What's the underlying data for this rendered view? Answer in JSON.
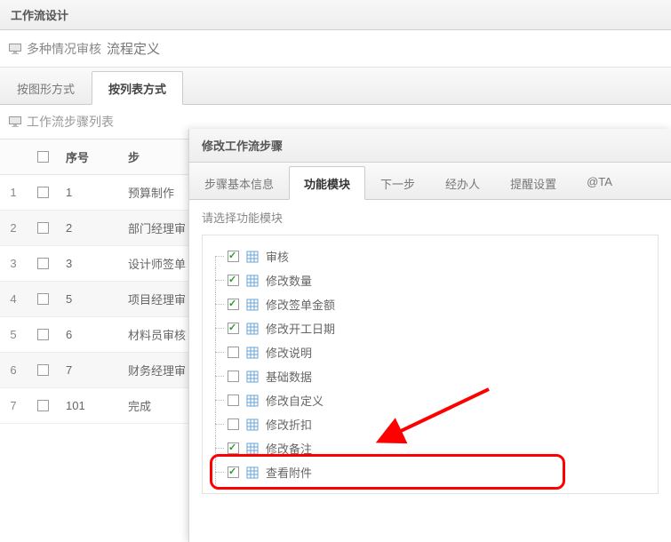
{
  "header": {
    "title": "工作流设计"
  },
  "subheader": {
    "breadcrumb1": "多种情况审核",
    "breadcrumb2": "流程定义"
  },
  "main_tabs": [
    {
      "label": "按图形方式",
      "active": false
    },
    {
      "label": "按列表方式",
      "active": true
    }
  ],
  "list_title": "工作流步骤列表",
  "table": {
    "headers": {
      "num": "序号",
      "name": "步"
    },
    "rows": [
      {
        "idx": "1",
        "num": "1",
        "name": "预算制作"
      },
      {
        "idx": "2",
        "num": "2",
        "name": "部门经理审"
      },
      {
        "idx": "3",
        "num": "3",
        "name": "设计师签单"
      },
      {
        "idx": "4",
        "num": "5",
        "name": "项目经理审"
      },
      {
        "idx": "5",
        "num": "6",
        "name": "材料员审核"
      },
      {
        "idx": "6",
        "num": "7",
        "name": "财务经理审"
      },
      {
        "idx": "7",
        "num": "101",
        "name": "完成"
      }
    ]
  },
  "panel": {
    "title": "修改工作流步骤",
    "tabs": [
      {
        "label": "步骤基本信息",
        "active": false
      },
      {
        "label": "功能模块",
        "active": true
      },
      {
        "label": "下一步",
        "active": false
      },
      {
        "label": "经办人",
        "active": false
      },
      {
        "label": "提醒设置",
        "active": false
      },
      {
        "label": "@TA",
        "active": false
      }
    ],
    "sub_label": "请选择功能模块",
    "modules": [
      {
        "label": "审核",
        "checked": true
      },
      {
        "label": "修改数量",
        "checked": true
      },
      {
        "label": "修改签单金额",
        "checked": true
      },
      {
        "label": "修改开工日期",
        "checked": true
      },
      {
        "label": "修改说明",
        "checked": false
      },
      {
        "label": "基础数据",
        "checked": false
      },
      {
        "label": "修改自定义",
        "checked": false
      },
      {
        "label": "修改折扣",
        "checked": false
      },
      {
        "label": "修改备注",
        "checked": true
      },
      {
        "label": "查看附件",
        "checked": true
      }
    ]
  }
}
